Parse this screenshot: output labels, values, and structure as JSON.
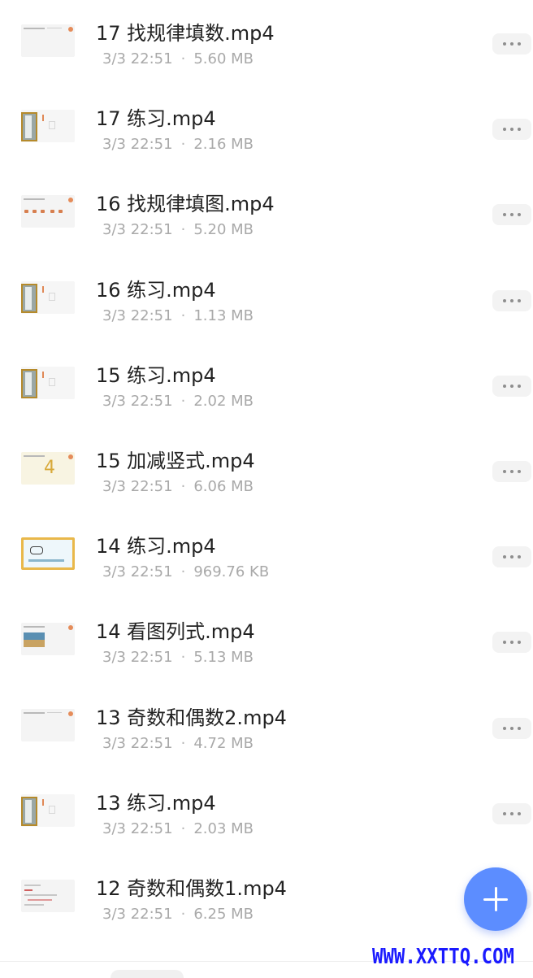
{
  "files": [
    {
      "name": "17 找规律填数.mp4",
      "date": "3/3 22:51",
      "size": "5.60 MB",
      "thumb": "plain"
    },
    {
      "name": "17 练习.mp4",
      "date": "3/3 22:51",
      "size": "2.16 MB",
      "thumb": "board"
    },
    {
      "name": "16 找规律填图.mp4",
      "date": "3/3 22:51",
      "size": "5.20 MB",
      "thumb": "dots"
    },
    {
      "name": "16 练习.mp4",
      "date": "3/3 22:51",
      "size": "1.13 MB",
      "thumb": "board"
    },
    {
      "name": "15 练习.mp4",
      "date": "3/3 22:51",
      "size": "2.02 MB",
      "thumb": "board"
    },
    {
      "name": "15 加减竖式.mp4",
      "date": "3/3 22:51",
      "size": "6.06 MB",
      "thumb": "cream"
    },
    {
      "name": "14 练习.mp4",
      "date": "3/3 22:51",
      "size": "969.76 KB",
      "thumb": "yellowframe"
    },
    {
      "name": "14  看图列式.mp4",
      "date": "3/3 22:51",
      "size": "5.13 MB",
      "thumb": "picture"
    },
    {
      "name": "13 奇数和偶数2.mp4",
      "date": "3/3 22:51",
      "size": "4.72 MB",
      "thumb": "plain"
    },
    {
      "name": "13 练习.mp4",
      "date": "3/3 22:51",
      "size": "2.03 MB",
      "thumb": "board"
    },
    {
      "name": "12 奇数和偶数1.mp4",
      "date": "3/3 22:51",
      "size": "6.25 MB",
      "thumb": "lines"
    }
  ],
  "separator": "·",
  "icons": {
    "more": "more-icon",
    "add": "plus-icon"
  },
  "colors": {
    "accent": "#5c8dff",
    "watermark": "#1a1aff"
  },
  "watermark": "WWW.XXTTQ.COM"
}
